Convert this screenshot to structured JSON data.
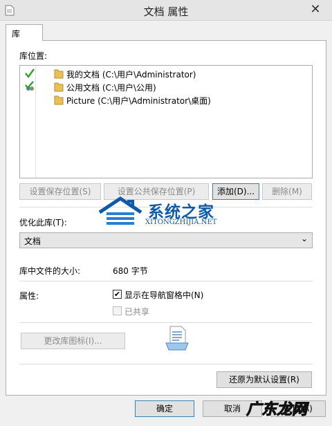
{
  "window": {
    "title": "文档 属性",
    "close_glyph": "✕"
  },
  "tab": {
    "label": "库"
  },
  "library_locations": {
    "label": "库位置:",
    "items": [
      {
        "label": "我的文档 (C:\\用户\\Administrator)",
        "status_icon": "check-icon"
      },
      {
        "label": "公用文档 (C:\\用户\\公用)",
        "status_icon": "shared-check-icon"
      },
      {
        "label": "Picture (C:\\用户\\Administrator\\桌面)",
        "status_icon": ""
      }
    ]
  },
  "location_buttons": {
    "set_save": "设置保存位置(S)",
    "set_public_save": "设置公共保存位置(P)",
    "add": "添加(D)...",
    "remove": "删除(M)"
  },
  "optimize": {
    "label": "优化此库(T):",
    "selected": "文档",
    "arrow": "⌄"
  },
  "size": {
    "label": "库中文件的大小:",
    "value": "680 字节"
  },
  "attributes": {
    "label": "属性:",
    "show_in_nav": {
      "label": "显示在导航窗格中(N)",
      "checked": true,
      "mark": "✔"
    },
    "shared": {
      "label": "已共享",
      "checked": false,
      "enabled": false
    }
  },
  "change_icon_button": "更改库图标(I)...",
  "restore_defaults_button": "还原为默认设置(R)",
  "dialog_buttons": {
    "ok": "确定",
    "cancel": "取消",
    "apply": "应用(A)"
  },
  "watermarks": {
    "site_name": "系统之家",
    "site_url": "XITONGZHIJIA.NET",
    "site2": "广东龙网"
  },
  "colors": {
    "accent": "#3c7fb1",
    "watermark_blue": "#0d5aa8",
    "check_green": "#2e9e2e"
  }
}
